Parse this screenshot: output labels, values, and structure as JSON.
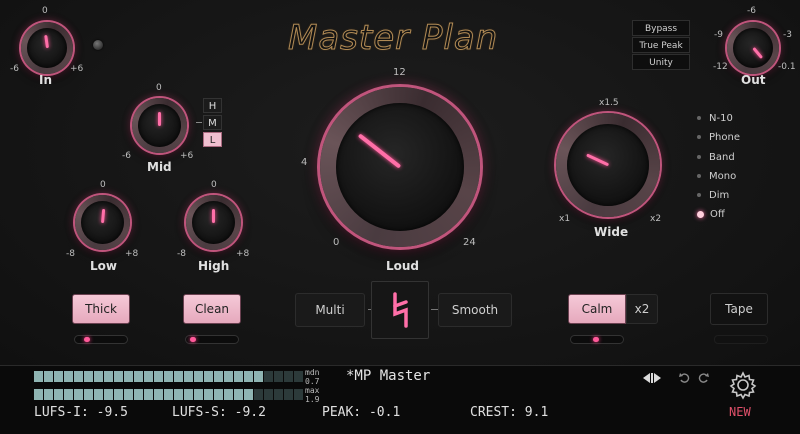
{
  "header": {
    "title": "Master Plan"
  },
  "top_buttons": [
    "Bypass",
    "True Peak",
    "Unity"
  ],
  "knobs": {
    "in": {
      "label": "In",
      "min": "-6",
      "max": "+6",
      "center": "0"
    },
    "out": {
      "label": "Out",
      "min": "-12",
      "max": "-0.1",
      "left": "-9",
      "right": "-3",
      "top": "-6"
    },
    "mid": {
      "label": "Mid",
      "min": "-6",
      "max": "+6",
      "center": "0"
    },
    "low": {
      "label": "Low",
      "min": "-8",
      "max": "+8",
      "center": "0"
    },
    "high": {
      "label": "High",
      "min": "-8",
      "max": "+8",
      "center": "0"
    },
    "loud": {
      "label": "Loud",
      "t0": "0",
      "t4": "4",
      "t12": "12",
      "t24": "24"
    },
    "wide": {
      "label": "Wide",
      "min": "x1",
      "max": "x2",
      "top": "x1.5"
    }
  },
  "hml": {
    "h": "H",
    "m": "M",
    "l": "L",
    "selected": "L"
  },
  "mode_list": {
    "items": [
      "N-10",
      "Phone",
      "Band",
      "Mono",
      "Dim",
      "Off"
    ],
    "selected": "Off"
  },
  "buttons": {
    "thick": "Thick",
    "clean": "Clean",
    "multi": "Multi",
    "smooth": "Smooth",
    "calm": "Calm",
    "x2": "x2",
    "tape": "Tape"
  },
  "meter": {
    "mdn_label": "mdn",
    "mdn_value": "0.7",
    "max_label": "max",
    "max_value": "1.9",
    "level_top": 0.85,
    "level_bottom": 0.8
  },
  "preset": {
    "name": "*MP Master"
  },
  "readouts": {
    "lufs_i": "LUFS-I: -9.5",
    "lufs_s": "LUFS-S: -9.2",
    "peak": "PEAK: -0.1",
    "crest": "CREST: 9.1"
  },
  "footer": {
    "new_label": "NEW"
  },
  "colors": {
    "accent": "#ff6fa8",
    "meter": "#8fb5b3",
    "new": "#e0506a"
  }
}
